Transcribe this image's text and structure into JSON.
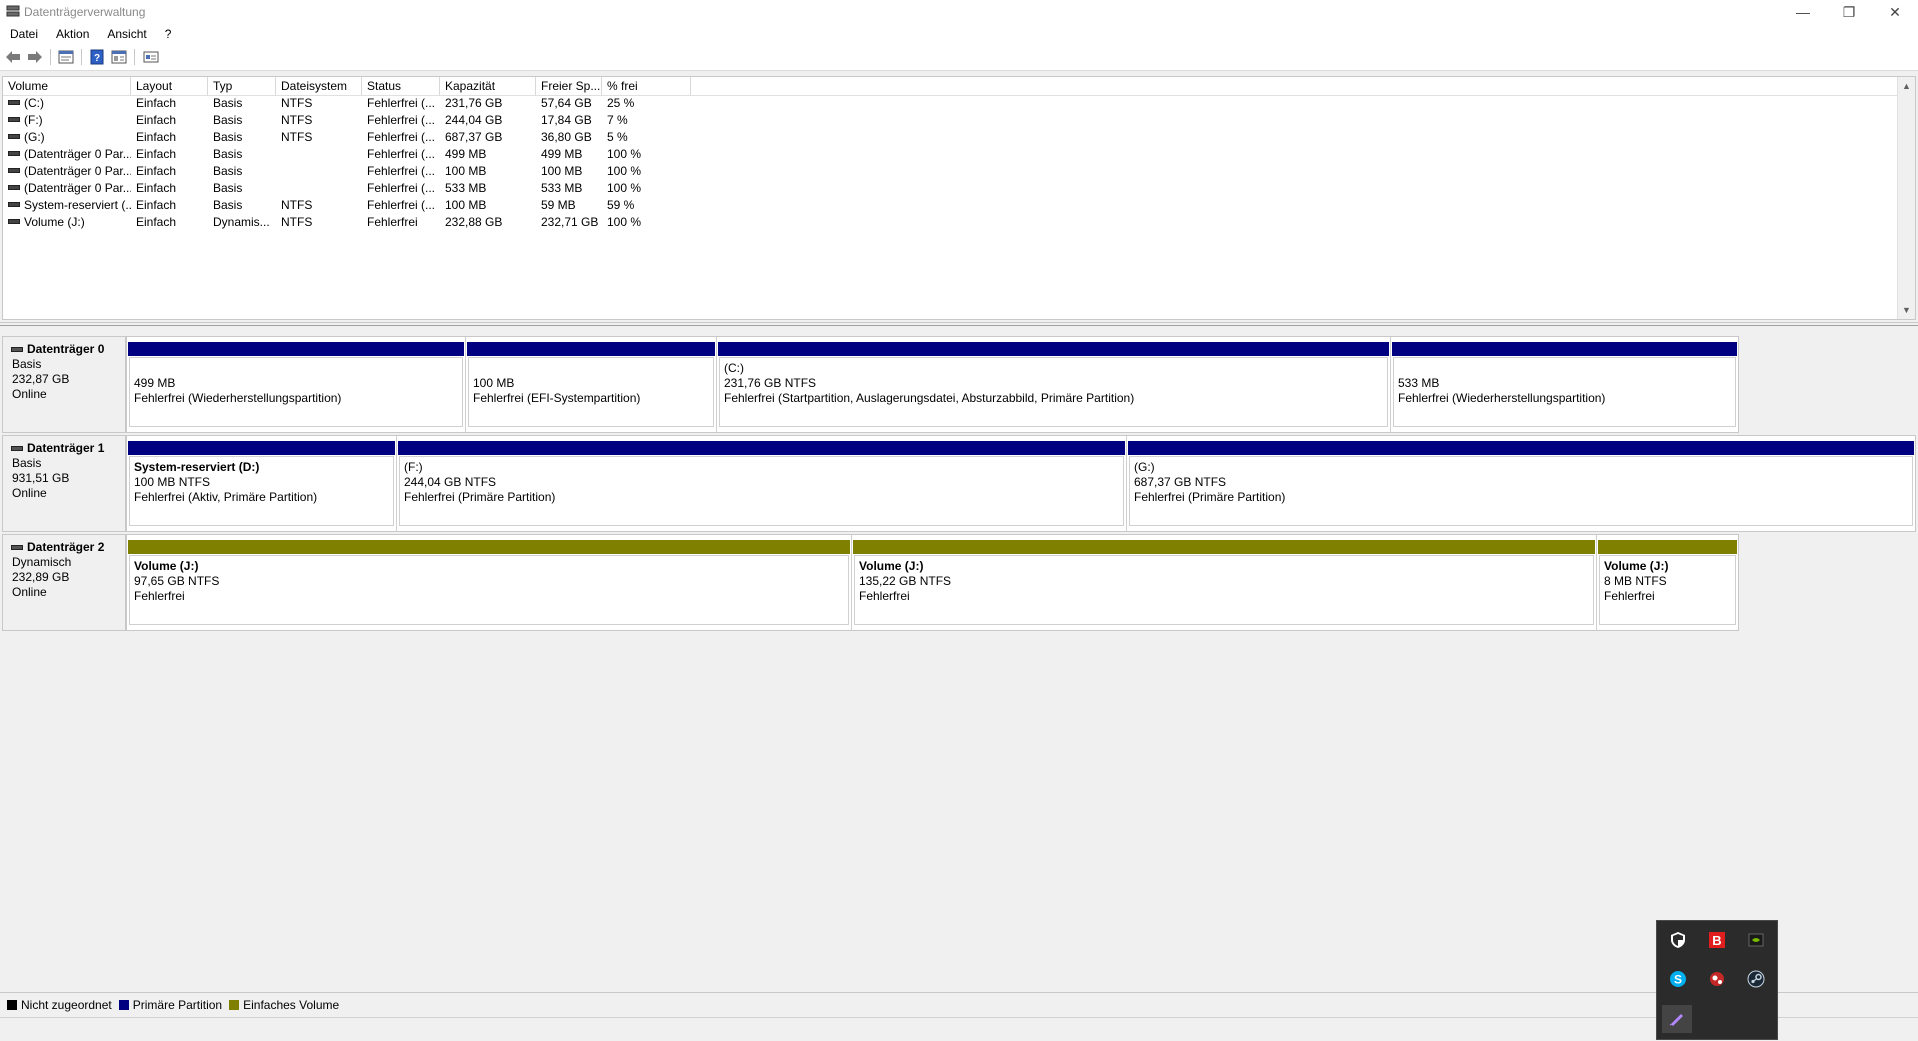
{
  "window": {
    "title": "Datenträgerverwaltung",
    "minimize_glyph": "—",
    "maximize_glyph": "❐",
    "close_glyph": "✕"
  },
  "menu": [
    "Datei",
    "Aktion",
    "Ansicht",
    "?"
  ],
  "toolbar": {
    "buttons": [
      "back-icon",
      "forward-icon",
      "properties-icon",
      "help-icon",
      "list-view-icon",
      "graphical-view-icon"
    ]
  },
  "volume_list": {
    "columns": [
      "Volume",
      "Layout",
      "Typ",
      "Dateisystem",
      "Status",
      "Kapazität",
      "Freier Sp...",
      "% frei"
    ],
    "rows": [
      [
        "(C:)",
        "Einfach",
        "Basis",
        "NTFS",
        "Fehlerfrei (...",
        "231,76 GB",
        "57,64 GB",
        "25 %"
      ],
      [
        "(F:)",
        "Einfach",
        "Basis",
        "NTFS",
        "Fehlerfrei (...",
        "244,04 GB",
        "17,84 GB",
        "7 %"
      ],
      [
        "(G:)",
        "Einfach",
        "Basis",
        "NTFS",
        "Fehlerfrei (...",
        "687,37 GB",
        "36,80 GB",
        "5 %"
      ],
      [
        "(Datenträger 0 Par...",
        "Einfach",
        "Basis",
        "",
        "Fehlerfrei (...",
        "499 MB",
        "499 MB",
        "100 %"
      ],
      [
        "(Datenträger 0 Par...",
        "Einfach",
        "Basis",
        "",
        "Fehlerfrei (...",
        "100 MB",
        "100 MB",
        "100 %"
      ],
      [
        "(Datenträger 0 Par...",
        "Einfach",
        "Basis",
        "",
        "Fehlerfrei (...",
        "533 MB",
        "533 MB",
        "100 %"
      ],
      [
        "System-reserviert (...",
        "Einfach",
        "Basis",
        "NTFS",
        "Fehlerfrei (...",
        "100 MB",
        "59 MB",
        "59 %"
      ],
      [
        "Volume (J:)",
        "Einfach",
        "Dynamis...",
        "NTFS",
        "Fehlerfrei",
        "232,88 GB",
        "232,71 GB",
        "100 %"
      ]
    ]
  },
  "disks": [
    {
      "name": "Datenträger 0",
      "type": "Basis",
      "size": "232,87 GB",
      "state": "Online",
      "partitions": [
        {
          "name": "",
          "size": "499 MB",
          "status": "Fehlerfrei (Wiederherstellungspartition)",
          "kind": "primary"
        },
        {
          "name": "",
          "size": "100 MB",
          "status": "Fehlerfrei (EFI-Systempartition)",
          "kind": "primary"
        },
        {
          "name": "(C:)",
          "size": "231,76 GB NTFS",
          "status": "Fehlerfrei (Startpartition, Auslagerungsdatei, Absturzabbild, Primäre Partition)",
          "kind": "primary"
        },
        {
          "name": "",
          "size": "533 MB",
          "status": "Fehlerfrei (Wiederherstellungspartition)",
          "kind": "primary"
        }
      ]
    },
    {
      "name": "Datenträger 1",
      "type": "Basis",
      "size": "931,51 GB",
      "state": "Online",
      "partitions": [
        {
          "name": "System-reserviert  (D:)",
          "size": "100 MB NTFS",
          "status": "Fehlerfrei (Aktiv, Primäre Partition)",
          "kind": "primary"
        },
        {
          "name": "(F:)",
          "size": "244,04 GB NTFS",
          "status": "Fehlerfrei (Primäre Partition)",
          "kind": "primary"
        },
        {
          "name": "(G:)",
          "size": "687,37 GB NTFS",
          "status": "Fehlerfrei (Primäre Partition)",
          "kind": "primary"
        }
      ]
    },
    {
      "name": "Datenträger 2",
      "type": "Dynamisch",
      "size": "232,89 GB",
      "state": "Online",
      "partitions": [
        {
          "name": "Volume  (J:)",
          "size": "97,65 GB NTFS",
          "status": "Fehlerfrei",
          "kind": "simple"
        },
        {
          "name": "Volume  (J:)",
          "size": "135,22 GB NTFS",
          "status": "Fehlerfrei",
          "kind": "simple"
        },
        {
          "name": "Volume  (J:)",
          "size": "8 MB NTFS",
          "status": "Fehlerfrei",
          "kind": "simple"
        }
      ]
    }
  ],
  "legend": [
    {
      "label": "Nicht zugeordnet",
      "color": "#000000"
    },
    {
      "label": "Primäre Partition",
      "color": "#000080"
    },
    {
      "label": "Einfaches Volume",
      "color": "#808000"
    }
  ],
  "colors": {
    "primary": "#000080",
    "simple": "#808000",
    "unallocated": "#000000"
  },
  "tray": [
    "defender-icon",
    "bitdefender-icon",
    "nvidia-icon",
    "skype-icon",
    "red-app-icon",
    "steam-icon",
    "pen-icon"
  ]
}
